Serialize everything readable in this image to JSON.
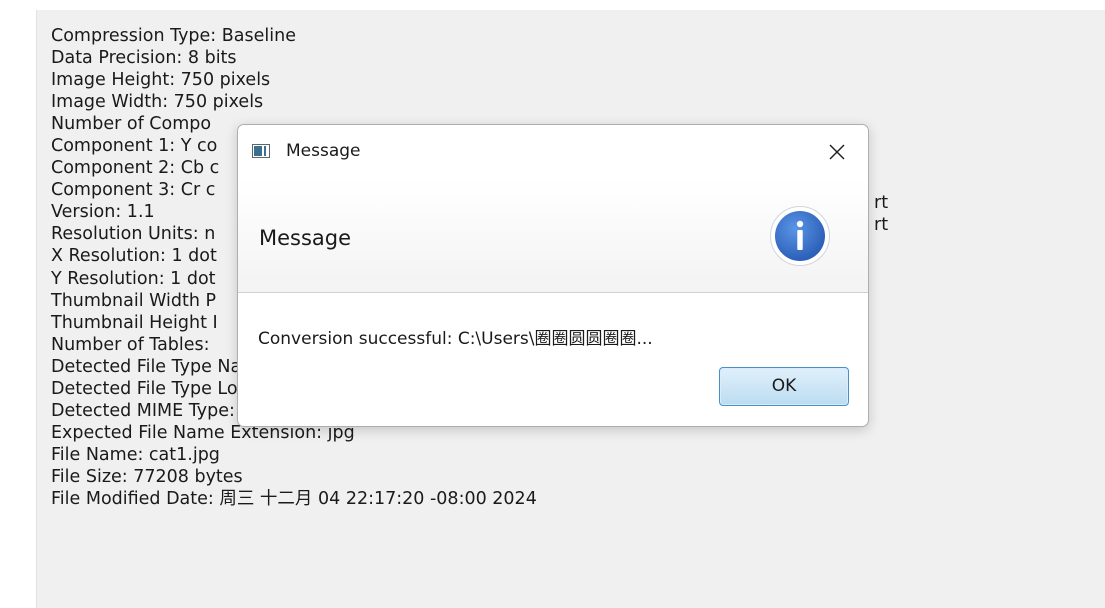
{
  "metadata_lines": [
    "Compression Type: Baseline",
    "Data Precision: 8 bits",
    "Image Height: 750 pixels",
    "Image Width: 750 pixels",
    "Number of Compo",
    "Component 1: Y co",
    "Component 2: Cb c",
    "Component 3: Cr c",
    "Version: 1.1",
    "Resolution Units: n",
    "X Resolution: 1 dot",
    "Y Resolution: 1 dot",
    "Thumbnail Width P",
    "Thumbnail Height I",
    "Number of Tables:",
    "Detected File Type Name: JPEG",
    "Detected File Type Long Name: Joint Photographic Experts Group",
    "Detected MIME Type: image/jpeg",
    "Expected File Name Extension: jpg",
    "File Name: cat1.jpg",
    "File Size: 77208 bytes",
    "File Modified Date: 周三 十二月 04 22:17:20 -08:00 2024"
  ],
  "overflow_fragments": [
    "rt",
    "rt"
  ],
  "dialog": {
    "title": "Message",
    "header_text": "Message",
    "content_text": "Conversion successful: C:\\Users\\圈圈圆圆圈圈...",
    "ok_label": "OK",
    "icons": {
      "app": "app-window-icon",
      "close": "close-icon",
      "info": "info-icon"
    },
    "colors": {
      "info_fill": "#3a73cf",
      "ok_border": "#4a90c8",
      "ok_fill": "#bcdcf1"
    }
  }
}
